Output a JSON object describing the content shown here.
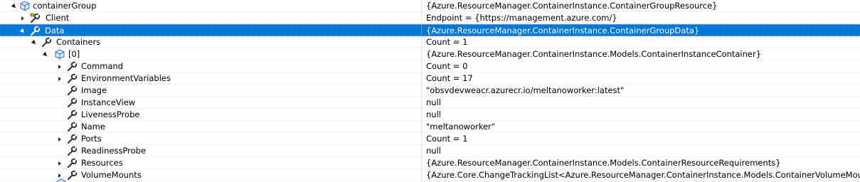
{
  "watch": {
    "rows": [
      {
        "name": "containerGroup",
        "value": "{Azure.ResourceManager.ContainerInstance.ContainerGroupResource}",
        "icon": "object-icon",
        "expander": "expanded"
      },
      {
        "name": "Client",
        "value": "Endpoint = {https://management.azure.com/}",
        "icon": "property-lock-icon",
        "expander": "collapsed"
      },
      {
        "name": "Data",
        "value": "{Azure.ResourceManager.ContainerInstance.ContainerGroupData}",
        "icon": "wrench-icon",
        "expander": "expanded",
        "selected": true
      },
      {
        "name": "Containers",
        "value": "Count = 1",
        "icon": "wrench-icon",
        "expander": "expanded"
      },
      {
        "name": "[0]",
        "value": "{Azure.ResourceManager.ContainerInstance.Models.ContainerInstanceContainer}",
        "icon": "object-icon",
        "expander": "expanded"
      },
      {
        "name": "Command",
        "value": "Count = 0",
        "icon": "wrench-icon",
        "expander": "collapsed"
      },
      {
        "name": "EnvironmentVariables",
        "value": "Count = 17",
        "icon": "wrench-icon",
        "expander": "collapsed"
      },
      {
        "name": "Image",
        "value": "\"obsvdevweacr.azurecr.io/meltanoworker:latest\"",
        "icon": "wrench-icon",
        "expander": "none"
      },
      {
        "name": "InstanceView",
        "value": "null",
        "icon": "wrench-icon",
        "expander": "none"
      },
      {
        "name": "LivenessProbe",
        "value": "null",
        "icon": "wrench-icon",
        "expander": "none"
      },
      {
        "name": "Name",
        "value": "\"meltanoworker\"",
        "icon": "wrench-icon",
        "expander": "none"
      },
      {
        "name": "Ports",
        "value": "Count = 1",
        "icon": "wrench-icon",
        "expander": "collapsed"
      },
      {
        "name": "ReadinessProbe",
        "value": "null",
        "icon": "wrench-icon",
        "expander": "none"
      },
      {
        "name": "Resources",
        "value": "{Azure.ResourceManager.ContainerInstance.Models.ContainerResourceRequirements}",
        "icon": "wrench-icon",
        "expander": "collapsed"
      },
      {
        "name": "VolumeMounts",
        "value": "{Azure.Core.ChangeTrackingList<Azure.ResourceManager.ContainerInstance.Models.ContainerVolumeMount>}",
        "icon": "wrench-icon",
        "expander": "collapsed"
      }
    ]
  },
  "colors": {
    "selection": "#0078d7",
    "wrench": "#3a3a3a",
    "object_icon": "#5b8fcf"
  }
}
